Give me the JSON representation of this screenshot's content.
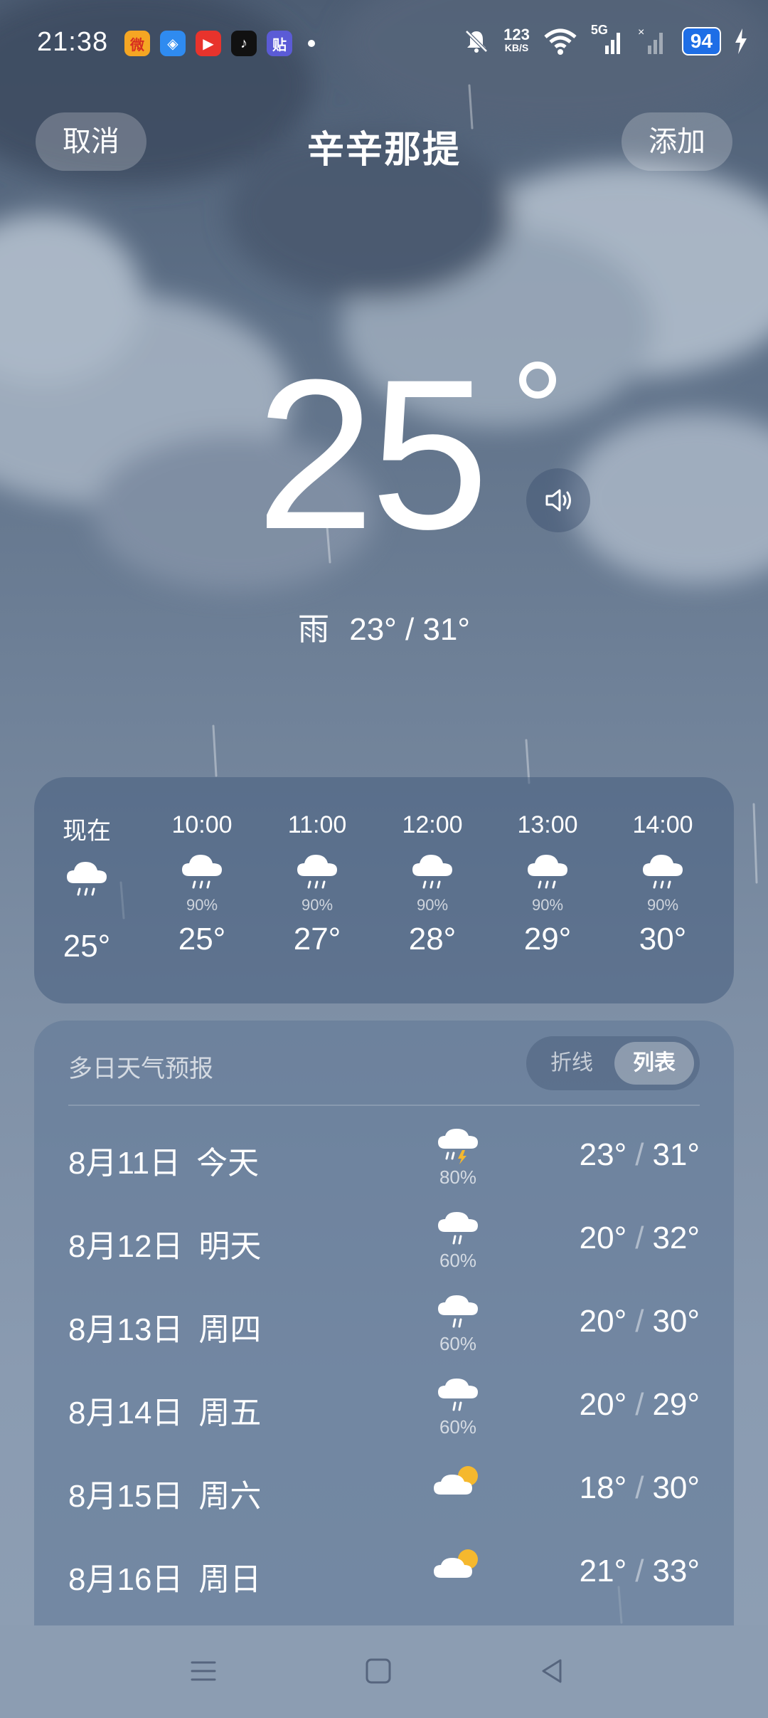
{
  "status_bar": {
    "time": "21:38",
    "net_speed_value": "123",
    "net_speed_unit": "KB/S",
    "network": "5G",
    "battery": "94",
    "app_icons": [
      "weibo-icon",
      "browser-icon",
      "video-icon",
      "tiktok-icon",
      "tieba-icon"
    ]
  },
  "header": {
    "cancel_label": "取消",
    "city": "辛辛那提",
    "add_label": "添加"
  },
  "current": {
    "temp": "25",
    "condition": "雨",
    "range": "23° / 31°"
  },
  "hourly": [
    {
      "time": "现在",
      "icon": "rain-icon",
      "prob": "",
      "temp": "25°"
    },
    {
      "time": "10:00",
      "icon": "rain-icon",
      "prob": "90%",
      "temp": "25°"
    },
    {
      "time": "11:00",
      "icon": "rain-icon",
      "prob": "90%",
      "temp": "27°"
    },
    {
      "time": "12:00",
      "icon": "rain-icon",
      "prob": "90%",
      "temp": "28°"
    },
    {
      "time": "13:00",
      "icon": "rain-icon",
      "prob": "90%",
      "temp": "29°"
    },
    {
      "time": "14:00",
      "icon": "rain-icon",
      "prob": "90%",
      "temp": "30°"
    }
  ],
  "daily": {
    "title": "多日天气预报",
    "toggle_line": "折线",
    "toggle_list": "列表",
    "days": [
      {
        "date": "8月11日",
        "weekday": "今天",
        "icon": "thunderstorm-icon",
        "prob": "80%",
        "low": "23°",
        "high": "31°"
      },
      {
        "date": "8月12日",
        "weekday": "明天",
        "icon": "rain-icon",
        "prob": "60%",
        "low": "20°",
        "high": "32°"
      },
      {
        "date": "8月13日",
        "weekday": "周四",
        "icon": "rain-icon",
        "prob": "60%",
        "low": "20°",
        "high": "30°"
      },
      {
        "date": "8月14日",
        "weekday": "周五",
        "icon": "rain-icon",
        "prob": "60%",
        "low": "20°",
        "high": "29°"
      },
      {
        "date": "8月15日",
        "weekday": "周六",
        "icon": "partly-cloudy-icon",
        "prob": "",
        "low": "18°",
        "high": "30°"
      },
      {
        "date": "8月16日",
        "weekday": "周日",
        "icon": "partly-cloudy-icon",
        "prob": "",
        "low": "21°",
        "high": "33°"
      }
    ]
  },
  "colors": {
    "battery": "#1e6ee6",
    "sun": "#f5b82e"
  }
}
